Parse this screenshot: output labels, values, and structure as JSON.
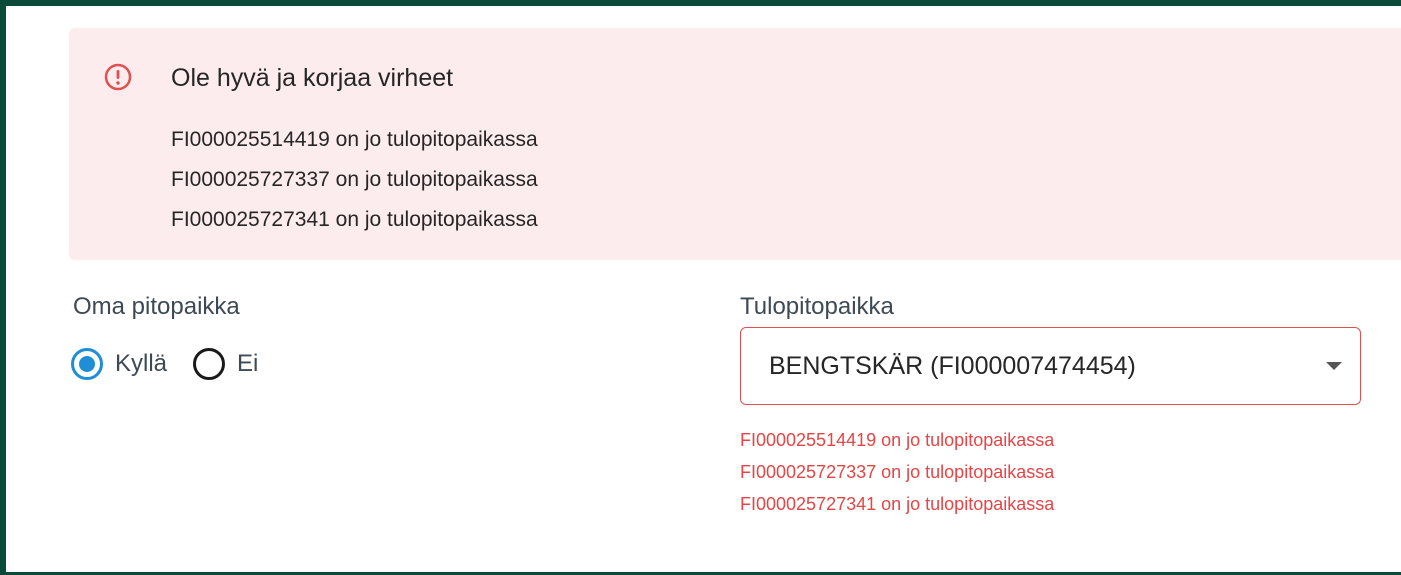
{
  "alert": {
    "icon": "alert-circle-icon",
    "title": "Ole hyvä ja korjaa virheet",
    "messages": [
      "FI000025514419 on jo tulopitopaikassa",
      "FI000025727337 on jo tulopitopaikassa",
      "FI000025727341 on jo tulopitopaikassa"
    ]
  },
  "oma_pitopaikka": {
    "label": "Oma pitopaikka",
    "options": [
      {
        "label": "Kyllä",
        "selected": true
      },
      {
        "label": "Ei",
        "selected": false
      }
    ]
  },
  "tulopitopaikka": {
    "label": "Tulopitopaikka",
    "value": "BENGTSKÄR (FI000007474454)",
    "icon": "caret-down-icon",
    "errors": [
      "FI000025514419 on jo tulopitopaikassa",
      "FI000025727337 on jo tulopitopaikassa",
      "FI000025727341 on jo tulopitopaikassa"
    ]
  },
  "colors": {
    "frame": "#0b4a38",
    "alert_background": "#fdeced",
    "error_text": "#e64545",
    "radio_selected": "#1f8ed6"
  }
}
